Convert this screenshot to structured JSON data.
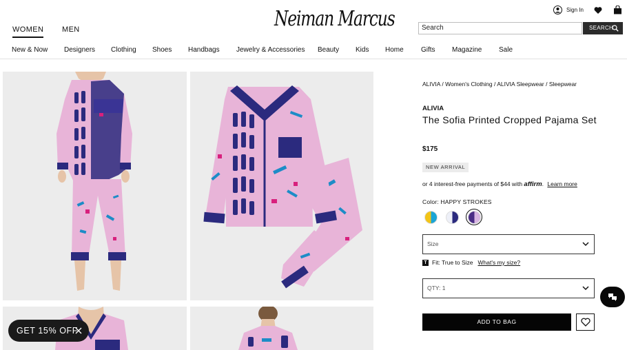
{
  "header": {
    "gender_tabs": [
      {
        "label": "WOMEN",
        "active": true
      },
      {
        "label": "MEN",
        "active": false
      }
    ],
    "logo": "Neiman Marcus",
    "sign_in": "Sign In",
    "search": {
      "placeholder": "Search",
      "button": "SEARCH"
    },
    "nav": [
      "New & Now",
      "Designers",
      "Clothing",
      "Shoes",
      "Handbags",
      "Jewelry & Accessories",
      "Beauty",
      "Kids",
      "Home",
      "Gifts",
      "Magazine",
      "Sale"
    ]
  },
  "product": {
    "breadcrumb": "ALIVIA / Women's Clothing / ALIVIA Sleepwear / Sleepwear",
    "brand": "ALIVIA",
    "name": "The Sofia Printed Cropped Pajama Set",
    "price": "$175",
    "badge": "NEW ARRIVAL",
    "installments": {
      "text": "or 4 interest-free payments of $44 with",
      "provider": "affirm",
      "link": "Learn more"
    },
    "color": {
      "label": "Color: HAPPY STROKES",
      "swatches": [
        {
          "name": "yellow-blue",
          "colors": [
            "#f2c418",
            "#1aa5d6"
          ],
          "selected": false
        },
        {
          "name": "white-navy",
          "colors": [
            "#eef0f8",
            "#2b2a7e"
          ],
          "selected": false
        },
        {
          "name": "purple-lilac",
          "colors": [
            "#4b2d86",
            "#d8b5e2"
          ],
          "selected": true
        }
      ]
    },
    "size_select": "Size",
    "fit": {
      "text": "Fit: True to Size",
      "link": "What's my size?"
    },
    "qty_select": "QTY: 1",
    "add_to_bag": "ADD TO BAG"
  },
  "promo": {
    "label": "GET 15% OFF"
  },
  "colors": {
    "primary": "#050505",
    "pajama_pink": "#e9b6d9",
    "pajama_navy": "#2a2478",
    "accent_magenta": "#d8207d"
  }
}
